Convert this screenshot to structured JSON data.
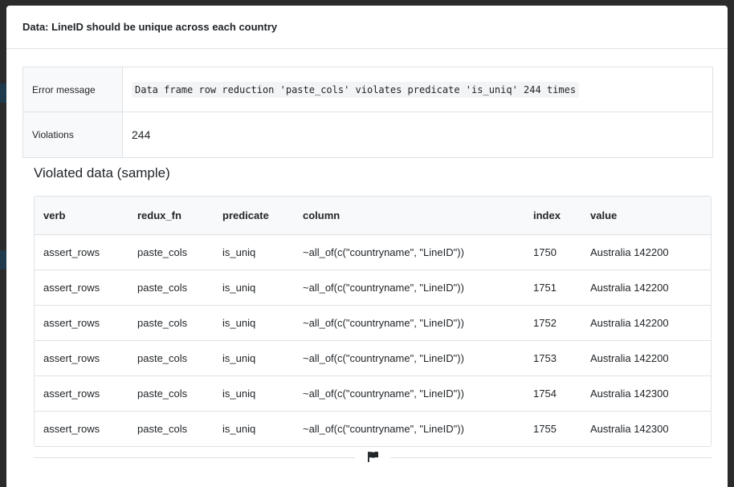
{
  "modal": {
    "title": "Data: LineID should be unique across each country"
  },
  "meta": {
    "error_label": "Error message",
    "error_value": "Data frame row reduction 'paste_cols' violates predicate 'is_uniq' 244 times",
    "violations_label": "Violations",
    "violations_value": "244"
  },
  "sample": {
    "title": "Violated data (sample)",
    "columns": [
      "verb",
      "redux_fn",
      "predicate",
      "column",
      "index",
      "value"
    ],
    "rows": [
      [
        "assert_rows",
        "paste_cols",
        "is_uniq",
        "~all_of(c(\"countryname\", \"LineID\"))",
        "1750",
        "Australia 142200"
      ],
      [
        "assert_rows",
        "paste_cols",
        "is_uniq",
        "~all_of(c(\"countryname\", \"LineID\"))",
        "1751",
        "Australia 142200"
      ],
      [
        "assert_rows",
        "paste_cols",
        "is_uniq",
        "~all_of(c(\"countryname\", \"LineID\"))",
        "1752",
        "Australia 142200"
      ],
      [
        "assert_rows",
        "paste_cols",
        "is_uniq",
        "~all_of(c(\"countryname\", \"LineID\"))",
        "1753",
        "Australia 142200"
      ],
      [
        "assert_rows",
        "paste_cols",
        "is_uniq",
        "~all_of(c(\"countryname\", \"LineID\"))",
        "1754",
        "Australia 142300"
      ],
      [
        "assert_rows",
        "paste_cols",
        "is_uniq",
        "~all_of(c(\"countryname\", \"LineID\"))",
        "1755",
        "Australia 142300"
      ]
    ]
  },
  "footer": {
    "icon": "flag-icon"
  }
}
